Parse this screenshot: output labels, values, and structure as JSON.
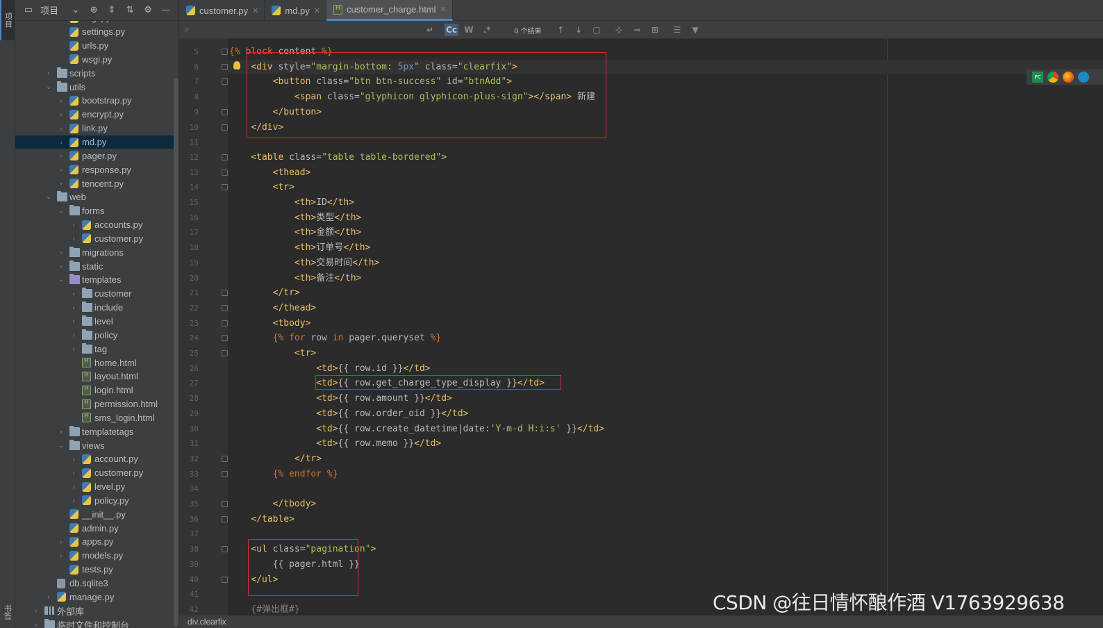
{
  "tool_strip": {
    "project_tab": "项目",
    "bookmarks_tab": "书签"
  },
  "project_panel": {
    "title": "项目",
    "tree": [
      {
        "label": "asgi.py",
        "type": "py",
        "indent": 3,
        "arrow": ""
      },
      {
        "label": "settings.py",
        "type": "py",
        "indent": 3,
        "arrow": ""
      },
      {
        "label": "urls.py",
        "type": "py",
        "indent": 3,
        "arrow": ""
      },
      {
        "label": "wsgi.py",
        "type": "py",
        "indent": 3,
        "arrow": ""
      },
      {
        "label": "scripts",
        "type": "folder",
        "indent": 2,
        "arrow": "right"
      },
      {
        "label": "utils",
        "type": "folder",
        "indent": 2,
        "arrow": "down"
      },
      {
        "label": "bootstrap.py",
        "type": "py",
        "indent": 3,
        "arrow": "right"
      },
      {
        "label": "encrypt.py",
        "type": "py",
        "indent": 3,
        "arrow": "right"
      },
      {
        "label": "link.py",
        "type": "py",
        "indent": 3,
        "arrow": "right"
      },
      {
        "label": "md.py",
        "type": "py",
        "indent": 3,
        "arrow": "right",
        "selected": true
      },
      {
        "label": "pager.py",
        "type": "py",
        "indent": 3,
        "arrow": "right"
      },
      {
        "label": "response.py",
        "type": "py",
        "indent": 3,
        "arrow": "right"
      },
      {
        "label": "tencent.py",
        "type": "py",
        "indent": 3,
        "arrow": "right"
      },
      {
        "label": "web",
        "type": "folder",
        "indent": 2,
        "arrow": "down"
      },
      {
        "label": "forms",
        "type": "folder",
        "indent": 3,
        "arrow": "down"
      },
      {
        "label": "accounts.py",
        "type": "py",
        "indent": 4,
        "arrow": "right"
      },
      {
        "label": "customer.py",
        "type": "py",
        "indent": 4,
        "arrow": "right"
      },
      {
        "label": "migrations",
        "type": "folder",
        "indent": 3,
        "arrow": "right"
      },
      {
        "label": "static",
        "type": "folder",
        "indent": 3,
        "arrow": "right"
      },
      {
        "label": "templates",
        "type": "folder-purple",
        "indent": 3,
        "arrow": "down"
      },
      {
        "label": "customer",
        "type": "folder",
        "indent": 4,
        "arrow": "right"
      },
      {
        "label": "include",
        "type": "folder",
        "indent": 4,
        "arrow": "right"
      },
      {
        "label": "level",
        "type": "folder",
        "indent": 4,
        "arrow": "right"
      },
      {
        "label": "policy",
        "type": "folder",
        "indent": 4,
        "arrow": "right"
      },
      {
        "label": "tag",
        "type": "folder",
        "indent": 4,
        "arrow": "right"
      },
      {
        "label": "home.html",
        "type": "html",
        "indent": 4,
        "arrow": ""
      },
      {
        "label": "layout.html",
        "type": "html",
        "indent": 4,
        "arrow": ""
      },
      {
        "label": "login.html",
        "type": "html",
        "indent": 4,
        "arrow": ""
      },
      {
        "label": "permission.html",
        "type": "html",
        "indent": 4,
        "arrow": ""
      },
      {
        "label": "sms_login.html",
        "type": "html",
        "indent": 4,
        "arrow": ""
      },
      {
        "label": "templatetags",
        "type": "folder",
        "indent": 3,
        "arrow": "right"
      },
      {
        "label": "views",
        "type": "folder",
        "indent": 3,
        "arrow": "down"
      },
      {
        "label": "account.py",
        "type": "py",
        "indent": 4,
        "arrow": "right"
      },
      {
        "label": "customer.py",
        "type": "py",
        "indent": 4,
        "arrow": "right"
      },
      {
        "label": "level.py",
        "type": "py",
        "indent": 4,
        "arrow": "right"
      },
      {
        "label": "policy.py",
        "type": "py",
        "indent": 4,
        "arrow": "right"
      },
      {
        "label": "__init__.py",
        "type": "py",
        "indent": 3,
        "arrow": ""
      },
      {
        "label": "admin.py",
        "type": "py",
        "indent": 3,
        "arrow": ""
      },
      {
        "label": "apps.py",
        "type": "py",
        "indent": 3,
        "arrow": "right"
      },
      {
        "label": "models.py",
        "type": "py",
        "indent": 3,
        "arrow": "right"
      },
      {
        "label": "tests.py",
        "type": "py",
        "indent": 3,
        "arrow": ""
      },
      {
        "label": "db.sqlite3",
        "type": "db",
        "indent": 2,
        "arrow": ""
      },
      {
        "label": "manage.py",
        "type": "py",
        "indent": 2,
        "arrow": "right"
      },
      {
        "label": "外部库",
        "type": "lib",
        "indent": 1,
        "arrow": "right"
      },
      {
        "label": "临时文件和控制台",
        "type": "folder",
        "indent": 1,
        "arrow": "right"
      }
    ]
  },
  "tabs": [
    {
      "label": "customer.py",
      "type": "py",
      "active": false
    },
    {
      "label": "md.py",
      "type": "py",
      "active": false
    },
    {
      "label": "customer_charge.html",
      "type": "html",
      "active": true
    }
  ],
  "search": {
    "placeholder": "",
    "match_case": "Cc",
    "words": "W",
    "regex": ".*",
    "result_count": "0 个结果"
  },
  "editor": {
    "first_line_number": 5,
    "current_line_index": 1,
    "lines": [
      [
        [
          "tpl",
          "{% "
        ],
        [
          "tpl",
          "block"
        ],
        [
          "attr",
          " content "
        ],
        [
          "tpl",
          "%}"
        ]
      ],
      [
        [
          "attr",
          "    "
        ],
        [
          "tag",
          "<div "
        ],
        [
          "attr",
          "style="
        ],
        [
          "str",
          "\"margin-bottom: "
        ],
        [
          "num",
          "5px"
        ],
        [
          "str",
          "\""
        ],
        [
          "attr",
          " class="
        ],
        [
          "str",
          "\"clearfix\""
        ],
        [
          "tag",
          ">"
        ]
      ],
      [
        [
          "attr",
          "        "
        ],
        [
          "tag",
          "<button "
        ],
        [
          "attr",
          "class="
        ],
        [
          "str",
          "\"btn btn-success\""
        ],
        [
          "attr",
          " id="
        ],
        [
          "str",
          "\"btnAdd\""
        ],
        [
          "tag",
          ">"
        ]
      ],
      [
        [
          "attr",
          "            "
        ],
        [
          "tag",
          "<span "
        ],
        [
          "attr",
          "class="
        ],
        [
          "str",
          "\"glyphicon glyphicon-plus-sign\""
        ],
        [
          "tag",
          "></span>"
        ],
        [
          "attr",
          " 新建"
        ]
      ],
      [
        [
          "attr",
          "        "
        ],
        [
          "tag",
          "</button>"
        ]
      ],
      [
        [
          "attr",
          "    "
        ],
        [
          "tag",
          "</div>"
        ]
      ],
      [],
      [
        [
          "attr",
          "    "
        ],
        [
          "tag",
          "<table "
        ],
        [
          "attr",
          "class="
        ],
        [
          "str",
          "\"table table-bordered\""
        ],
        [
          "tag",
          ">"
        ]
      ],
      [
        [
          "attr",
          "        "
        ],
        [
          "tag",
          "<thead>"
        ]
      ],
      [
        [
          "attr",
          "        "
        ],
        [
          "tag",
          "<tr>"
        ]
      ],
      [
        [
          "attr",
          "            "
        ],
        [
          "tag",
          "<th>"
        ],
        [
          "attr",
          "ID"
        ],
        [
          "tag",
          "</th>"
        ]
      ],
      [
        [
          "attr",
          "            "
        ],
        [
          "tag",
          "<th>"
        ],
        [
          "attr",
          "类型"
        ],
        [
          "tag",
          "</th>"
        ]
      ],
      [
        [
          "attr",
          "            "
        ],
        [
          "tag",
          "<th>"
        ],
        [
          "attr",
          "金额"
        ],
        [
          "tag",
          "</th>"
        ]
      ],
      [
        [
          "attr",
          "            "
        ],
        [
          "tag",
          "<th>"
        ],
        [
          "attr",
          "订单号"
        ],
        [
          "tag",
          "</th>"
        ]
      ],
      [
        [
          "attr",
          "            "
        ],
        [
          "tag",
          "<th>"
        ],
        [
          "attr",
          "交易时间"
        ],
        [
          "tag",
          "</th>"
        ]
      ],
      [
        [
          "attr",
          "            "
        ],
        [
          "tag",
          "<th>"
        ],
        [
          "attr",
          "备注"
        ],
        [
          "tag",
          "</th>"
        ]
      ],
      [
        [
          "attr",
          "        "
        ],
        [
          "tag",
          "</tr>"
        ]
      ],
      [
        [
          "attr",
          "        "
        ],
        [
          "tag",
          "</thead>"
        ]
      ],
      [
        [
          "attr",
          "        "
        ],
        [
          "tag",
          "<tbody>"
        ]
      ],
      [
        [
          "attr",
          "        "
        ],
        [
          "tpl",
          "{% "
        ],
        [
          "tpl",
          "for"
        ],
        [
          "attr",
          " row "
        ],
        [
          "tpl",
          "in"
        ],
        [
          "attr",
          " pager.queryset "
        ],
        [
          "tpl",
          "%}"
        ]
      ],
      [
        [
          "attr",
          "            "
        ],
        [
          "tag",
          "<tr>"
        ]
      ],
      [
        [
          "attr",
          "                "
        ],
        [
          "tag",
          "<td>"
        ],
        [
          "attr",
          "{{ row.id }}"
        ],
        [
          "tag",
          "</td>"
        ]
      ],
      [
        [
          "attr",
          "                "
        ],
        [
          "tag",
          "<td>"
        ],
        [
          "attr",
          "{{ row.get_charge_type_display }}"
        ],
        [
          "tag",
          "</td>"
        ]
      ],
      [
        [
          "attr",
          "                "
        ],
        [
          "tag",
          "<td>"
        ],
        [
          "attr",
          "{{ row.amount }}"
        ],
        [
          "tag",
          "</td>"
        ]
      ],
      [
        [
          "attr",
          "                "
        ],
        [
          "tag",
          "<td>"
        ],
        [
          "attr",
          "{{ row.order_oid }}"
        ],
        [
          "tag",
          "</td>"
        ]
      ],
      [
        [
          "attr",
          "                "
        ],
        [
          "tag",
          "<td>"
        ],
        [
          "attr",
          "{{ row.create_datetime|date:"
        ],
        [
          "str",
          "'Y-m-d H:i:s'"
        ],
        [
          "attr",
          " }}"
        ],
        [
          "tag",
          "</td>"
        ]
      ],
      [
        [
          "attr",
          "                "
        ],
        [
          "tag",
          "<td>"
        ],
        [
          "attr",
          "{{ row.memo }}"
        ],
        [
          "tag",
          "</td>"
        ]
      ],
      [
        [
          "attr",
          "            "
        ],
        [
          "tag",
          "</tr>"
        ]
      ],
      [
        [
          "attr",
          "        "
        ],
        [
          "tpl",
          "{% "
        ],
        [
          "tpl",
          "endfor"
        ],
        [
          "attr",
          " "
        ],
        [
          "tpl",
          "%}"
        ]
      ],
      [],
      [
        [
          "attr",
          "        "
        ],
        [
          "tag",
          "</tbody>"
        ]
      ],
      [
        [
          "attr",
          "    "
        ],
        [
          "tag",
          "</table>"
        ]
      ],
      [],
      [
        [
          "attr",
          "    "
        ],
        [
          "tag",
          "<ul "
        ],
        [
          "attr",
          "class="
        ],
        [
          "str",
          "\"pagination\""
        ],
        [
          "tag",
          ">"
        ]
      ],
      [
        [
          "attr",
          "        {{ pager.html }}"
        ]
      ],
      [
        [
          "attr",
          "    "
        ],
        [
          "tag",
          "</ul>"
        ]
      ],
      [],
      [
        [
          "cmt",
          "    {#弹出框#}"
        ]
      ]
    ]
  },
  "breadcrumb": "div.clearfix",
  "browser_icons": [
    "pycharm-icon",
    "chrome-icon",
    "firefox-icon",
    "edge-icon"
  ],
  "watermark": "CSDN @往日情怀酿作酒 V1763929638",
  "colors": {
    "background": "#2b2b2b",
    "panel": "#3c3f41",
    "selection": "#0d293e",
    "highlight_box": "#e0262b",
    "tag": "#e8bf6a",
    "string": "#a5c25c",
    "keyword": "#cc7832",
    "number": "#6897bb"
  }
}
